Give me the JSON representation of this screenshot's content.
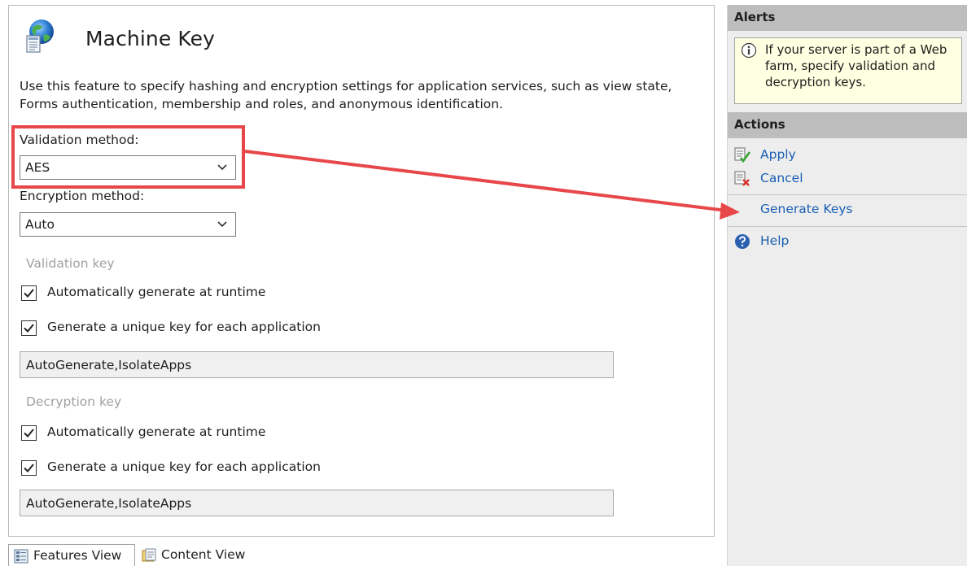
{
  "page": {
    "title": "Machine Key",
    "description": "Use this feature to specify hashing and encryption settings for application services, such as view state, Forms authentication, membership and roles, and anonymous identification."
  },
  "validation_method": {
    "label": "Validation method:",
    "value": "AES"
  },
  "encryption_method": {
    "label": "Encryption method:",
    "value": "Auto"
  },
  "validation_key": {
    "section_label": "Validation key",
    "auto_generate": {
      "label": "Automatically generate at runtime",
      "checked": true
    },
    "unique_key": {
      "label": "Generate a unique key for each application",
      "checked": true
    },
    "value": "AutoGenerate,IsolateApps"
  },
  "decryption_key": {
    "section_label": "Decryption key",
    "auto_generate": {
      "label": "Automatically generate at runtime",
      "checked": true
    },
    "unique_key": {
      "label": "Generate a unique key for each application",
      "checked": true
    },
    "value": "AutoGenerate,IsolateApps"
  },
  "tabs": [
    {
      "label": "Features View",
      "icon": "features-view-icon",
      "active": true
    },
    {
      "label": "Content View",
      "icon": "content-view-icon",
      "active": false
    }
  ],
  "alerts": {
    "header": "Alerts",
    "message": "If your server is part of a Web farm, specify validation and decryption keys.",
    "icon": "info-icon"
  },
  "actions": {
    "header": "Actions",
    "items": [
      {
        "label": "Apply",
        "icon": "apply-icon"
      },
      {
        "label": "Cancel",
        "icon": "cancel-icon"
      },
      {
        "label": "Generate Keys",
        "icon": "none"
      },
      {
        "label": "Help",
        "icon": "help-icon"
      }
    ]
  },
  "colors": {
    "annotation": "#e8474a",
    "link": "#1a5fb4",
    "alert_background": "#ffffe1",
    "pane_header": "#bdbdbd"
  }
}
